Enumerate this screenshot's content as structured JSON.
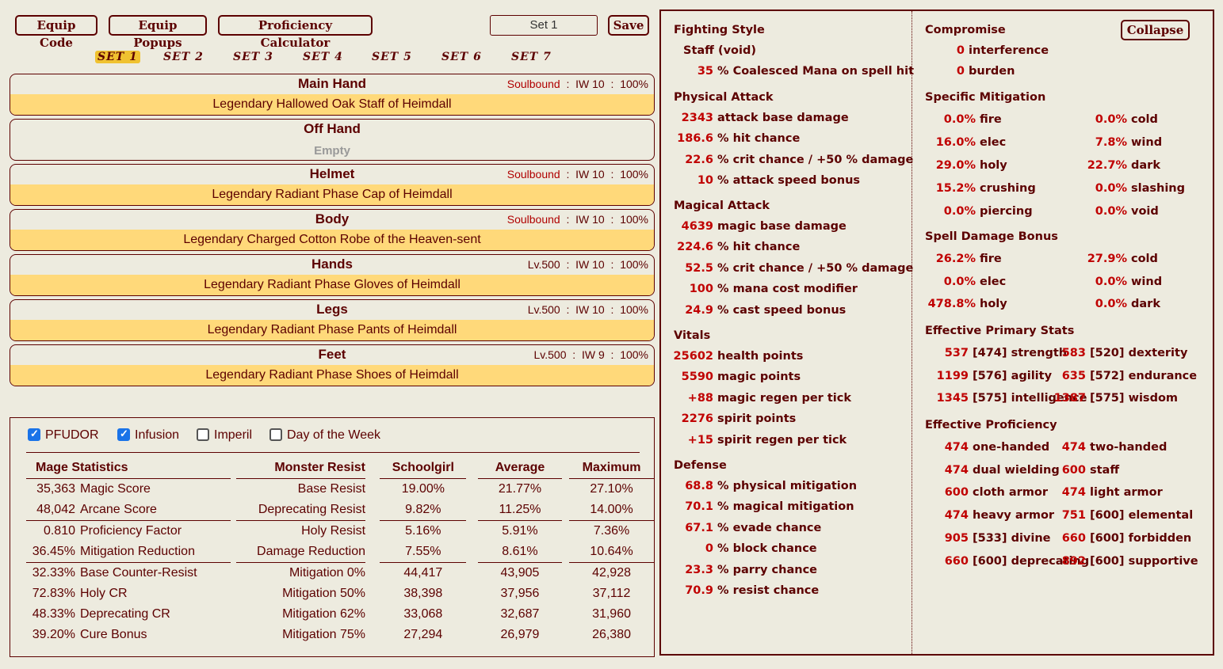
{
  "toolbar": {
    "equip_code": "Equip Code",
    "equip_popups": "Equip Popups",
    "proficiency_calculator": "Proficiency Calculator",
    "set_value": "Set 1",
    "save": "Save",
    "collapse": "Collapse"
  },
  "set_tabs": [
    "SET 1",
    "SET 2",
    "SET 3",
    "SET 4",
    "SET 5",
    "SET 6",
    "SET 7"
  ],
  "slots": [
    {
      "name": "Main Hand",
      "info1": "Soulbound",
      "info2": "IW 10",
      "info3": "100%",
      "item": "Legendary Hallowed Oak Staff of Heimdall"
    },
    {
      "name": "Off Hand",
      "empty": "Empty"
    },
    {
      "name": "Helmet",
      "info1": "Soulbound",
      "info2": "IW 10",
      "info3": "100%",
      "item": "Legendary Radiant Phase Cap of Heimdall"
    },
    {
      "name": "Body",
      "info1": "Soulbound",
      "info2": "IW 10",
      "info3": "100%",
      "item": "Legendary Charged Cotton Robe of the Heaven-sent"
    },
    {
      "name": "Hands",
      "info1": "Lv.500",
      "info2": "IW 10",
      "info3": "100%",
      "item": "Legendary Radiant Phase Gloves of Heimdall"
    },
    {
      "name": "Legs",
      "info1": "Lv.500",
      "info2": "IW 10",
      "info3": "100%",
      "item": "Legendary Radiant Phase Pants of Heimdall"
    },
    {
      "name": "Feet",
      "info1": "Lv.500",
      "info2": "IW 9",
      "info3": "100%",
      "item": "Legendary Radiant Phase Shoes of Heimdall"
    }
  ],
  "checkboxes": [
    {
      "label": "PFUDOR",
      "checked": true
    },
    {
      "label": "Infusion",
      "checked": true
    },
    {
      "label": "Imperil",
      "checked": false
    },
    {
      "label": "Day of the Week",
      "checked": false
    }
  ],
  "stats_table": {
    "headers": [
      "Mage Statistics",
      "Monster Resist",
      "Schoolgirl",
      "Average",
      "Maximum"
    ],
    "rows": [
      [
        "35,363",
        "Magic Score",
        "Base Resist",
        "19.00%",
        "21.77%",
        "27.10%"
      ],
      [
        "48,042",
        "Arcane Score",
        "Deprecating Resist",
        "9.82%",
        "11.25%",
        "14.00%"
      ],
      [
        "0.810",
        "Proficiency Factor",
        "Holy Resist",
        "5.16%",
        "5.91%",
        "7.36%"
      ],
      [
        "36.45%",
        "Mitigation Reduction",
        "Damage Reduction",
        "7.55%",
        "8.61%",
        "10.64%"
      ],
      [
        "32.33%",
        "Base Counter-Resist",
        "Mitigation 0%",
        "44,417",
        "43,905",
        "42,928"
      ],
      [
        "72.83%",
        "Holy CR",
        "Mitigation 50%",
        "38,398",
        "37,956",
        "37,112"
      ],
      [
        "48.33%",
        "Deprecating CR",
        "Mitigation 62%",
        "33,068",
        "32,687",
        "31,960"
      ],
      [
        "39.20%",
        "Cure Bonus",
        "Mitigation 75%",
        "27,294",
        "26,979",
        "26,380"
      ]
    ]
  },
  "col1": {
    "fighting_style": {
      "title": "Fighting Style",
      "style": "Staff (void)",
      "lines": [
        [
          "35",
          "% Coalesced Mana on spell hit"
        ]
      ]
    },
    "physical_attack": {
      "title": "Physical Attack",
      "lines": [
        [
          "2343",
          "attack base damage"
        ],
        [
          "186.6",
          "% hit chance"
        ],
        [
          "22.6",
          "% crit chance / +50 % damage"
        ],
        [
          "10",
          "% attack speed bonus"
        ]
      ]
    },
    "magical_attack": {
      "title": "Magical Attack",
      "lines": [
        [
          "4639",
          "magic base damage"
        ],
        [
          "224.6",
          "% hit chance"
        ],
        [
          "52.5",
          "% crit chance / +50 % damage"
        ],
        [
          "100",
          "% mana cost modifier"
        ],
        [
          "24.9",
          "% cast speed bonus"
        ]
      ]
    },
    "vitals": {
      "title": "Vitals",
      "lines": [
        [
          "25602",
          "health points"
        ],
        [
          "5590",
          "magic points"
        ],
        [
          "+88",
          "magic regen per tick"
        ],
        [
          "2276",
          "spirit points"
        ],
        [
          "+15",
          "spirit regen per tick"
        ]
      ]
    },
    "defense": {
      "title": "Defense",
      "lines": [
        [
          "68.8",
          "% physical mitigation"
        ],
        [
          "70.1",
          "% magical mitigation"
        ],
        [
          "67.1",
          "% evade chance"
        ],
        [
          "0",
          "% block chance"
        ],
        [
          "23.3",
          "% parry chance"
        ],
        [
          "70.9",
          "% resist chance"
        ]
      ]
    }
  },
  "col2": {
    "compromise": {
      "title": "Compromise",
      "lines": [
        [
          "0",
          "interference"
        ],
        [
          "0",
          "burden"
        ]
      ]
    },
    "specific_mitigation": {
      "title": "Specific Mitigation",
      "pairs": [
        [
          "0.0%",
          "fire",
          "0.0%",
          "cold"
        ],
        [
          "16.0%",
          "elec",
          "7.8%",
          "wind"
        ],
        [
          "29.0%",
          "holy",
          "22.7%",
          "dark"
        ],
        [
          "15.2%",
          "crushing",
          "0.0%",
          "slashing"
        ],
        [
          "0.0%",
          "piercing",
          "0.0%",
          "void"
        ]
      ]
    },
    "spell_damage": {
      "title": "Spell Damage Bonus",
      "pairs": [
        [
          "26.2%",
          "fire",
          "27.9%",
          "cold"
        ],
        [
          "0.0%",
          "elec",
          "0.0%",
          "wind"
        ],
        [
          "478.8%",
          "holy",
          "0.0%",
          "dark"
        ]
      ]
    },
    "primary_stats": {
      "title": "Effective Primary Stats",
      "pairs": [
        [
          "537",
          "[474] strength",
          "583",
          "[520] dexterity"
        ],
        [
          "1199",
          "[576] agility",
          "635",
          "[572] endurance"
        ],
        [
          "1345",
          "[575] intelligence",
          "1387",
          "[575] wisdom"
        ]
      ]
    },
    "proficiency": {
      "title": "Effective Proficiency",
      "pairs": [
        [
          "474",
          "one-handed",
          "474",
          "two-handed"
        ],
        [
          "474",
          "dual wielding",
          "600",
          "staff"
        ],
        [
          "600",
          "cloth armor",
          "474",
          "light armor"
        ],
        [
          "474",
          "heavy armor",
          "751",
          "[600] elemental"
        ],
        [
          "905",
          "[533] divine",
          "660",
          "[600] forbidden"
        ],
        [
          "660",
          "[600] deprecating",
          "892",
          "[600] supportive"
        ]
      ]
    }
  }
}
